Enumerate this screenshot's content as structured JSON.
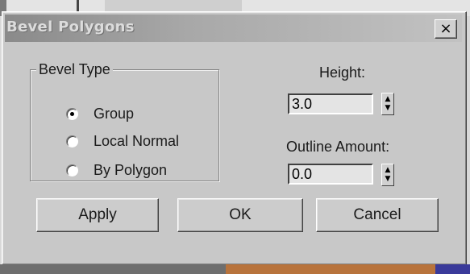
{
  "dialog": {
    "title": "Bevel Polygons",
    "close_label": "×"
  },
  "bevel_type": {
    "legend": "Bevel Type",
    "options": [
      {
        "label": "Group",
        "selected": true
      },
      {
        "label": "Local Normal",
        "selected": false
      },
      {
        "label": "By Polygon",
        "selected": false
      }
    ]
  },
  "height": {
    "label": "Height:",
    "value": "3.0"
  },
  "outline_amount": {
    "label": "Outline Amount:",
    "value": "0.0"
  },
  "buttons": {
    "apply": "Apply",
    "ok": "OK",
    "cancel": "Cancel"
  },
  "spinner": {
    "up": "▲",
    "down": "▼"
  }
}
